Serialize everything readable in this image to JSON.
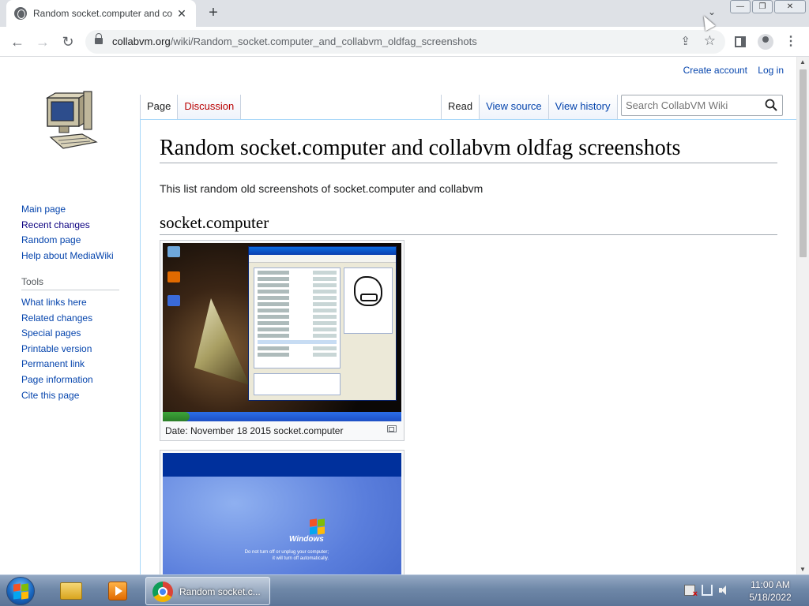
{
  "browser": {
    "tab_title": "Random socket.computer and collabvm oldfag screenshots",
    "tab_close": "✕",
    "new_tab": "+",
    "tab_search": "⌄",
    "url_host": "collabvm.org",
    "url_path": "/wiki/Random_socket.computer_and_collabvm_oldfag_screenshots",
    "back": "←",
    "forward": "→",
    "reload": "↻",
    "share": "⇪",
    "star": "☆",
    "menu": "⋮",
    "minimize": "—",
    "restore": "❐",
    "close": "✕"
  },
  "personal": {
    "create_account": "Create account",
    "log_in": "Log in"
  },
  "tabs": {
    "page": "Page",
    "discussion": "Discussion",
    "read": "Read",
    "view_source": "View source",
    "view_history": "View history"
  },
  "search": {
    "placeholder": "Search CollabVM Wiki"
  },
  "sidebar": {
    "navigation": [
      {
        "label": "Main page"
      },
      {
        "label": "Recent changes"
      },
      {
        "label": "Random page"
      },
      {
        "label": "Help about MediaWiki"
      }
    ],
    "tools_heading": "Tools",
    "tools": [
      {
        "label": "What links here"
      },
      {
        "label": "Related changes"
      },
      {
        "label": "Special pages"
      },
      {
        "label": "Printable version"
      },
      {
        "label": "Permanent link"
      },
      {
        "label": "Page information"
      },
      {
        "label": "Cite this page"
      }
    ]
  },
  "article": {
    "title": "Random socket.computer and collabvm oldfag screenshots",
    "intro": "This list random old screenshots of socket.computer and collabvm",
    "section1": "socket.computer",
    "thumb1_caption": "Date: November 18 2015 socket.computer",
    "thumb2_brand": "Windows",
    "thumb2_message_line1": "Do not turn off or unplug your computer;",
    "thumb2_message_line2": "it will turn off automatically."
  },
  "taskbar": {
    "chrome_label": "Random socket.c...",
    "time": "11:00 AM",
    "date": "5/18/2022"
  },
  "colors": {
    "link": "#0645ad",
    "new_link": "#ba0000",
    "tab_border": "#a7d7f9"
  }
}
